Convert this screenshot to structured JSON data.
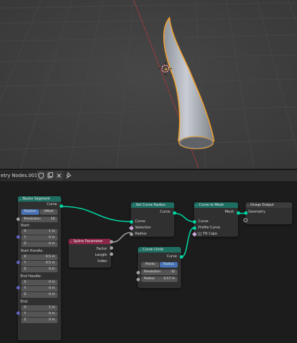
{
  "editor": {
    "tree_name": "etry Nodes.001"
  },
  "nodes": {
    "bezier": {
      "title": "Bezier Segment",
      "output_curve": "Curve",
      "mode_position": "Position",
      "mode_offset": "Offset",
      "resolution_label": "Resolution",
      "resolution_value": "16",
      "start_label": "Start:",
      "start": [
        {
          "axis": "X",
          "value": "1 m"
        },
        {
          "axis": "Y",
          "value": "0 m"
        },
        {
          "axis": "Z",
          "value": "0 m"
        }
      ],
      "start_handle_label": "Start Handle:",
      "start_handle": [
        {
          "axis": "X",
          "value": "0.5 m"
        },
        {
          "axis": "Y",
          "value": "0.5 m"
        },
        {
          "axis": "Z",
          "value": "0 m"
        }
      ],
      "end_handle_label": "End Handle:",
      "end_handle": [
        {
          "axis": "X",
          "value": "0 m"
        },
        {
          "axis": "Y",
          "value": "0 m"
        },
        {
          "axis": "Z",
          "value": "0 m"
        }
      ],
      "end_label": "End:",
      "end": [
        {
          "axis": "X",
          "value": "1 m"
        },
        {
          "axis": "Y",
          "value": "0 m"
        },
        {
          "axis": "Z",
          "value": "0 m"
        }
      ]
    },
    "spline_param": {
      "title": "Spline Parameter",
      "outputs": [
        "Factor",
        "Length",
        "Index"
      ]
    },
    "set_radius": {
      "title": "Set Curve Radius",
      "output": "Curve",
      "inputs": [
        "Curve",
        "Selection",
        "Radius"
      ]
    },
    "curve_circle": {
      "title": "Curve Circle",
      "output": "Curve",
      "mode_points": "Points",
      "mode_radius": "Radius",
      "resolution_label": "Resolution",
      "resolution_value": "32",
      "radius_label": "Radius",
      "radius_value": "0.17 m"
    },
    "curve_to_mesh": {
      "title": "Curve to Mesh",
      "output": "Mesh",
      "inputs": [
        "Curve",
        "Profile Curve",
        "Fill Caps"
      ]
    },
    "group_output": {
      "title": "Group Output",
      "inputs": [
        "Geometry"
      ]
    }
  },
  "colors": {
    "viewport_bg": "#3d3d3d",
    "geometry_socket": "#00d6a3",
    "vector_socket": "#6363c7",
    "float_socket": "#a1a1a1",
    "geometry_header": "#1e6e61",
    "input_header": "#8a2746",
    "output_header": "#3c3c3c",
    "selection_outline": "#f0a030",
    "active_button": "#4772b3"
  },
  "icons": [
    "shield-icon",
    "duplicate-icon",
    "close-icon",
    "pin-icon",
    "cursor-3d-icon"
  ]
}
